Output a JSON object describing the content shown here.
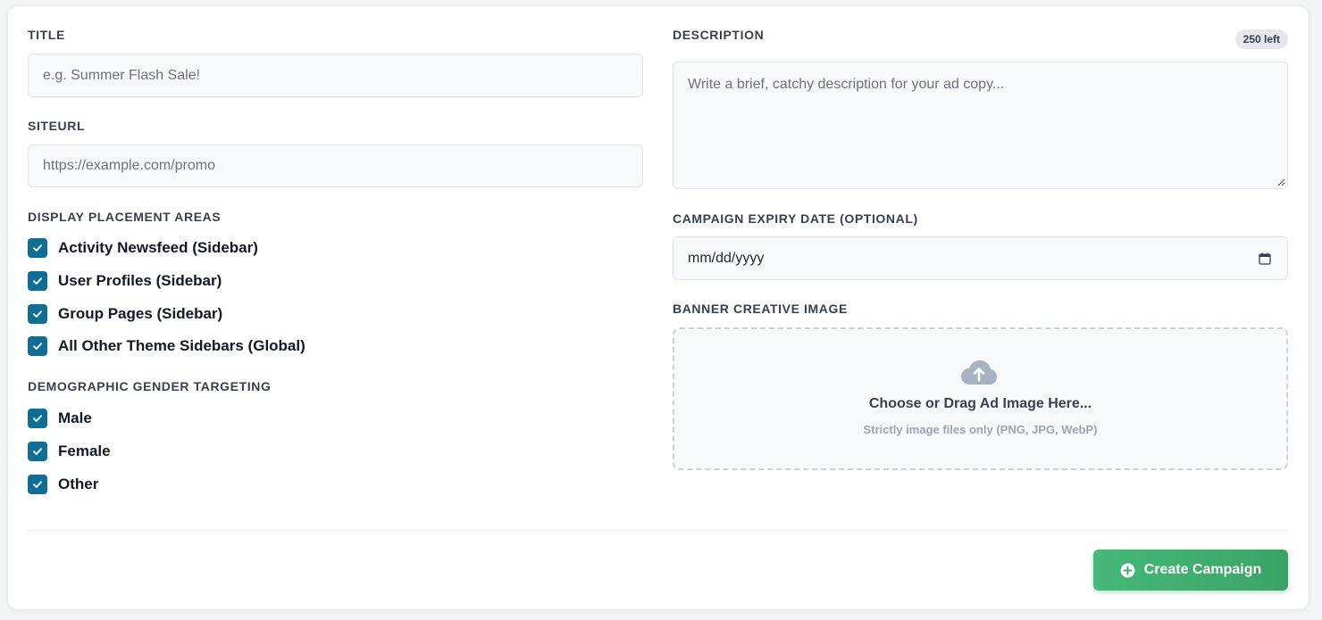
{
  "form": {
    "title": {
      "label": "TITLE",
      "placeholder": "e.g. Summer Flash Sale!"
    },
    "siteurl": {
      "label": "SITEURL",
      "placeholder": "https://example.com/promo"
    },
    "placement": {
      "label": "DISPLAY PLACEMENT AREAS",
      "options": [
        {
          "label": "Activity Newsfeed (Sidebar)",
          "checked": true
        },
        {
          "label": "User Profiles (Sidebar)",
          "checked": true
        },
        {
          "label": "Group Pages (Sidebar)",
          "checked": true
        },
        {
          "label": "All Other Theme Sidebars (Global)",
          "checked": true
        }
      ]
    },
    "gender": {
      "label": "DEMOGRAPHIC GENDER TARGETING",
      "options": [
        {
          "label": "Male",
          "checked": true
        },
        {
          "label": "Female",
          "checked": true
        },
        {
          "label": "Other",
          "checked": true
        }
      ]
    },
    "description": {
      "label": "DESCRIPTION",
      "counter": "250 left",
      "placeholder": "Write a brief, catchy description for your ad copy..."
    },
    "expiry": {
      "label": "CAMPAIGN EXPIRY DATE (OPTIONAL)",
      "placeholder": "mm/dd/yyyy",
      "icon": "calendar-icon"
    },
    "banner": {
      "label": "BANNER CREATIVE IMAGE",
      "icon": "cloud-upload-icon",
      "title": "Choose or Drag Ad Image Here...",
      "hint": "Strictly image files only (PNG, JPG, WebP)"
    },
    "submit": {
      "label": "Create Campaign",
      "icon": "plus-circle-icon"
    }
  },
  "colors": {
    "checkbox": "#0f6e96",
    "button": "#3fae6e",
    "background": "#f3f4f6"
  }
}
